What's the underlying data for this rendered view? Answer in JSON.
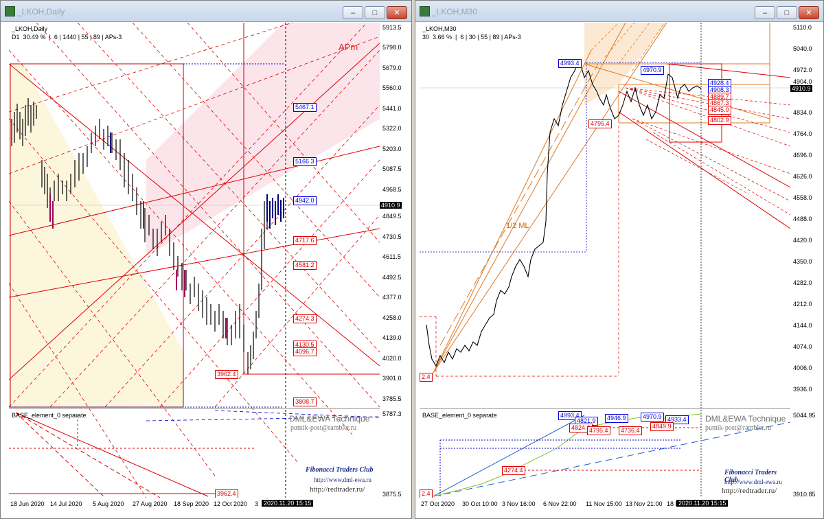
{
  "left_window": {
    "title": "_LKOH,Daily",
    "info_symbol": "_LKOH,Daily",
    "info_line": "D1  30.49 %  |  6 | 1440 | 55 | 89 | APs-3",
    "price_ticks": [
      "5913.5",
      "5798.0",
      "5679.0",
      "5560.0",
      "5441.0",
      "5322.0",
      "5203.0",
      "5087.5",
      "4968.5",
      "4849.5",
      "4730.5",
      "4611.5",
      "4492.5",
      "4377.0",
      "4258.0",
      "4139.0",
      "4020.0",
      "3901.0",
      "3785.5"
    ],
    "current_price": "4910.9",
    "sub_ticks": [
      "5787.3",
      "3875.5"
    ],
    "time_ticks": [
      "18 Jun 2020",
      "14 Jul 2020",
      "5 Aug 2020",
      "27 Aug 2020",
      "18 Sep 2020",
      "12 Oct 2020",
      "3"
    ],
    "time_box": "2020.11.20 15:15",
    "level_labels": [
      {
        "text": "5467.1",
        "color": "blue"
      },
      {
        "text": "5166.3",
        "color": "blue"
      },
      {
        "text": "4942.0",
        "color": "blue"
      },
      {
        "text": "4717.6",
        "color": "red"
      },
      {
        "text": "4581.2",
        "color": "red"
      },
      {
        "text": "4274.3",
        "color": "red"
      },
      {
        "text": "4130.5",
        "color": "red"
      },
      {
        "text": "4096.7",
        "color": "red"
      },
      {
        "text": "3962.4",
        "color": "red"
      },
      {
        "text": "3808.7",
        "color": "red"
      },
      {
        "text": "3962.4",
        "color": "red"
      }
    ],
    "apm_label": "APm",
    "subwindow_title": "BASE_element_0 separate",
    "dml": "DML&EWA Technique",
    "mail": "putnik-post@rambler.ru",
    "fib_club": "Fibonacci Traders Club",
    "fib_url": "http://www.dml-ewa.ru",
    "redtrader": "http://redtrader.ru/"
  },
  "right_window": {
    "title": "_LKOH,M30",
    "info_symbol": "_LKOH,M30",
    "info_line": "30  3.66 %  |  6 | 30 | 55 | 89 | APs-3",
    "price_ticks": [
      "5110.0",
      "5040.0",
      "4972.0",
      "4904.0",
      "4834.0",
      "4764.0",
      "4696.0",
      "4626.0",
      "4558.0",
      "4488.0",
      "4420.0",
      "4350.0",
      "4282.0",
      "4212.0",
      "4144.0",
      "4074.0",
      "4006.0",
      "3936.0"
    ],
    "current_price": "4910.9",
    "sub_ticks": [
      "5044.95",
      "3910.85"
    ],
    "time_ticks": [
      "27 Oct 2020",
      "30 Oct 10:00",
      "3 Nov 16:00",
      "6 Nov 22:00",
      "11 Nov 15:00",
      "13 Nov 21:00",
      "18 N"
    ],
    "time_box": "2020.11.20 15:15",
    "level_labels": [
      {
        "text": "4993.4",
        "color": "blue"
      },
      {
        "text": "4970.9",
        "color": "blue"
      },
      {
        "text": "4928.4",
        "color": "blue"
      },
      {
        "text": "4908.3",
        "color": "blue"
      },
      {
        "text": "4889.7",
        "color": "red"
      },
      {
        "text": "4867.3",
        "color": "red"
      },
      {
        "text": "4845.0",
        "color": "red"
      },
      {
        "text": "4802.9",
        "color": "red"
      },
      {
        "text": "4795.4",
        "color": "red"
      },
      {
        "text": "2.4",
        "color": "red"
      }
    ],
    "sub_labels": [
      {
        "text": "4993.4",
        "color": "blue"
      },
      {
        "text": "4821.9",
        "color": "blue"
      },
      {
        "text": "4946.9",
        "color": "blue"
      },
      {
        "text": "4970.9",
        "color": "blue"
      },
      {
        "text": "4933.4",
        "color": "blue"
      },
      {
        "text": "4824.6",
        "color": "red"
      },
      {
        "text": "4795.4",
        "color": "red"
      },
      {
        "text": "4736.4",
        "color": "red"
      },
      {
        "text": "4849.9",
        "color": "red"
      },
      {
        "text": "4274.4",
        "color": "red"
      },
      {
        "text": "2.4",
        "color": "red"
      }
    ],
    "half_ml_label": "1/2 ML",
    "subwindow_title": "BASE_element_0 separate",
    "dml": "DML&EWA Technique",
    "mail": "putnik-post@rambler.ru",
    "fib_club": "Fibonacci Traders Club",
    "fib_url": "http://www.dml-ewa.ru",
    "redtrader": "http://redtrader.ru/"
  },
  "colors": {
    "red": "#e00000",
    "blue": "#0000e0",
    "orange": "#e07820",
    "pink_band": "#fbe4ea",
    "cream_band": "#fbf6dc",
    "candle_magenta": "#a0005a",
    "candle_navy": "#000080"
  },
  "icons": {
    "minimize": "minimize-icon",
    "maximize": "maximize-icon",
    "close": "close-icon"
  }
}
